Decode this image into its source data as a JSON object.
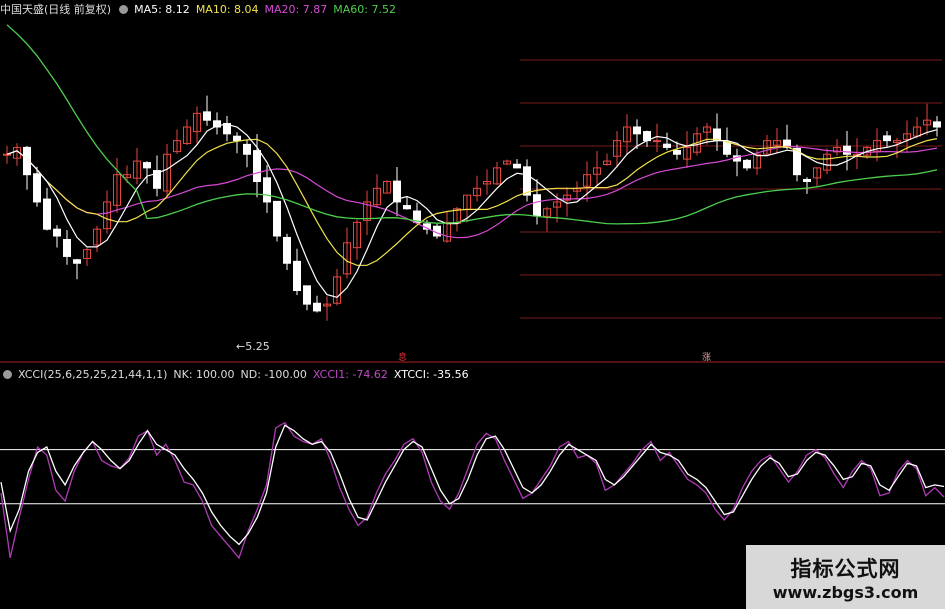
{
  "header": {
    "title": "中国天盛(日线 前复权)",
    "ma5": "MA5: 8.12",
    "ma10": "MA10: 8.04",
    "ma20": "MA20: 7.87",
    "ma60": "MA60: 7.52"
  },
  "indicator": {
    "label": "XCCI(25,6,25,25,21,44,1,1)",
    "nk": "NK: 100.00",
    "nd": "ND: -100.00",
    "xcci1": "XCCI1: -74.62",
    "xtcci": "XTCCI: -35.56"
  },
  "annotations": {
    "low_price": "←5.25",
    "marker_1": "息",
    "marker_2": "涨"
  },
  "watermark": {
    "title": "指标公式网",
    "url": "www.zbgs3.com"
  },
  "colors": {
    "background": "#000000",
    "up_candle": "#e8473f",
    "down_candle": "#ffffff",
    "ma5": "#ffffff",
    "ma10": "#f2e24a",
    "ma20": "#d64ad6",
    "ma60": "#4ccf4c",
    "grid": "#7a1c1c",
    "xcci1": "#b03ab8",
    "xtcci": "#ffffff",
    "level_line": "#ffffff"
  },
  "chart_data": [
    {
      "type": "line",
      "subtype": "candlestick",
      "series": [
        {
          "name": "MA5",
          "latest": 8.12
        },
        {
          "name": "MA10",
          "latest": 8.04
        },
        {
          "name": "MA20",
          "latest": 7.87
        },
        {
          "name": "MA60",
          "latest": 7.52
        }
      ],
      "close": [
        7.6,
        7.7,
        7.3,
        6.9,
        6.5,
        6.4,
        6.1,
        6.0,
        6.2,
        6.5,
        6.9,
        7.3,
        7.3,
        7.5,
        7.4,
        7.1,
        7.6,
        7.8,
        8.0,
        8.2,
        8.1,
        8.0,
        7.9,
        7.8,
        7.6,
        7.2,
        6.9,
        6.4,
        6.0,
        5.6,
        5.4,
        5.3,
        5.4,
        5.8,
        6.3,
        6.6,
        6.9,
        7.1,
        7.2,
        6.9,
        6.8,
        6.6,
        6.5,
        6.4,
        6.6,
        6.8,
        7.0,
        7.1,
        7.2,
        7.4,
        7.5,
        7.4,
        7.0,
        6.7,
        6.8,
        6.9,
        7.0,
        7.1,
        7.3,
        7.4,
        7.5,
        7.8,
        8.0,
        7.9,
        7.8,
        7.8,
        7.7,
        7.6,
        7.7,
        7.9,
        8.0,
        7.8,
        7.6,
        7.5,
        7.4,
        7.6,
        7.8,
        7.8,
        7.7,
        7.3,
        7.2,
        7.4,
        7.6,
        7.7,
        7.6,
        7.6,
        7.7,
        7.8,
        7.8,
        7.8,
        7.9,
        8.0,
        8.1,
        8.0
      ],
      "ylim": [
        4.8,
        9.6
      ],
      "low_annotation": 5.25,
      "grid": true
    },
    {
      "type": "line",
      "name": "XCCI",
      "params": "25,6,25,25,21,44,1,1",
      "levels": {
        "NK": 100.0,
        "ND": -100.0
      },
      "series": [
        {
          "name": "XCCI1",
          "latest": -74.62,
          "values": [
            -60,
            -300,
            -150,
            -10,
            110,
            80,
            -50,
            -90,
            20,
            90,
            130,
            60,
            40,
            30,
            70,
            150,
            170,
            80,
            120,
            60,
            -20,
            -30,
            -90,
            -180,
            -220,
            -260,
            -300,
            -200,
            -120,
            -30,
            180,
            200,
            150,
            130,
            120,
            140,
            60,
            -40,
            -120,
            -180,
            -150,
            -60,
            10,
            60,
            120,
            140,
            90,
            -20,
            -90,
            -120,
            -60,
            30,
            120,
            160,
            140,
            60,
            -10,
            -80,
            -60,
            -10,
            40,
            110,
            130,
            70,
            80,
            50,
            -50,
            -30,
            10,
            50,
            100,
            130,
            60,
            90,
            40,
            -10,
            -30,
            -60,
            -120,
            -160,
            -120,
            -40,
            20,
            60,
            80,
            30,
            -20,
            20,
            80,
            100,
            70,
            10,
            -40,
            20,
            60,
            30,
            -70,
            -60,
            20,
            60,
            30,
            -70,
            -40,
            -75
          ]
        },
        {
          "name": "XTCCI",
          "latest": -35.56,
          "values": [
            -20,
            -200,
            -120,
            20,
            90,
            110,
            20,
            -30,
            40,
            90,
            130,
            100,
            60,
            30,
            60,
            120,
            170,
            120,
            100,
            80,
            30,
            -10,
            -60,
            -130,
            -180,
            -220,
            -250,
            -210,
            -150,
            -60,
            110,
            190,
            170,
            140,
            120,
            130,
            90,
            10,
            -80,
            -150,
            -160,
            -90,
            -20,
            40,
            100,
            130,
            110,
            30,
            -50,
            -100,
            -80,
            -10,
            80,
            140,
            150,
            100,
            30,
            -40,
            -60,
            -30,
            20,
            80,
            120,
            100,
            80,
            60,
            -10,
            -30,
            0,
            40,
            80,
            120,
            90,
            80,
            60,
            10,
            -10,
            -40,
            -90,
            -140,
            -130,
            -70,
            -10,
            40,
            70,
            50,
            0,
            10,
            60,
            90,
            80,
            40,
            -10,
            0,
            50,
            40,
            -30,
            -50,
            0,
            50,
            40,
            -40,
            -30,
            -36
          ]
        }
      ],
      "ylim": [
        -400,
        350
      ]
    }
  ]
}
